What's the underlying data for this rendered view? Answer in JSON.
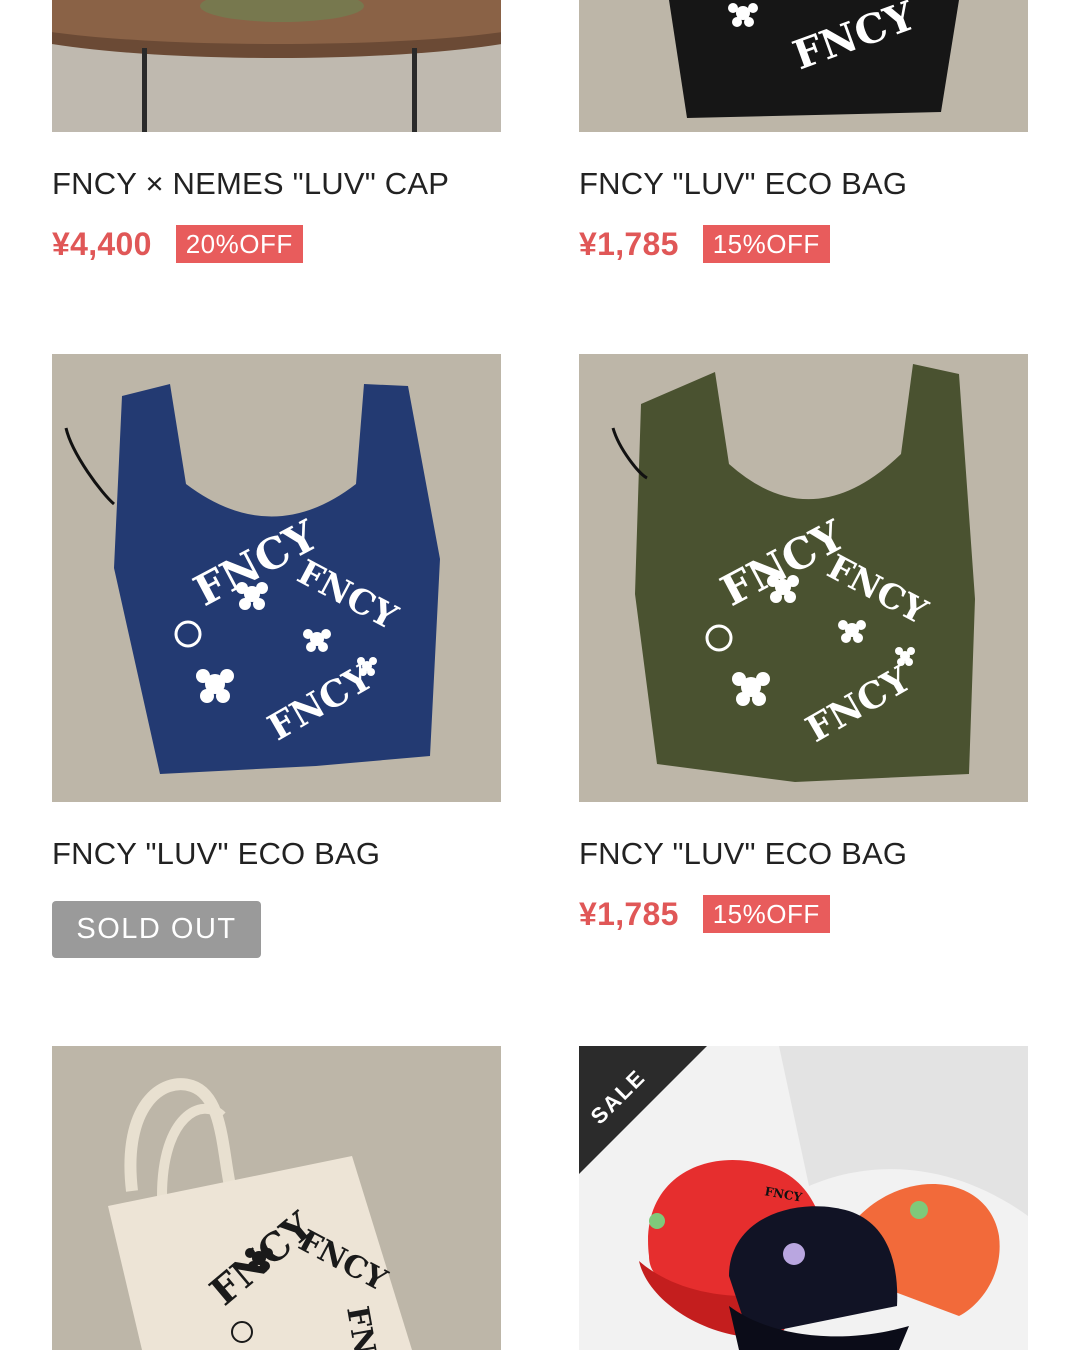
{
  "products": [
    {
      "title": "FNCY × NEMES \"LUV\" CAP",
      "price": "¥4,400",
      "discount": "20%OFF",
      "status": ""
    },
    {
      "title": "FNCY \"LUV\" ECO BAG",
      "price": "¥1,785",
      "discount": "15%OFF",
      "status": ""
    },
    {
      "title": "FNCY \"LUV\" ECO BAG",
      "price": "",
      "discount": "",
      "status": "SOLD OUT",
      "bag_color": "#233a72"
    },
    {
      "title": "FNCY \"LUV\" ECO BAG",
      "price": "¥1,785",
      "discount": "15%OFF",
      "status": "",
      "bag_color": "#4a5230"
    },
    {
      "title": "",
      "price": "",
      "discount": "",
      "status": "",
      "bag_color": "#ede4d6"
    },
    {
      "title": "",
      "price": "",
      "discount": "",
      "status": "",
      "ribbon": "SALE"
    }
  ],
  "colors": {
    "price_red": "#e05757",
    "off_badge": "#e85c5c",
    "sold_out_badge": "#9a9a9a",
    "carpet": "#bdb6a8"
  },
  "icons": [
    "flower-icon",
    "logo-mascot-icon"
  ]
}
